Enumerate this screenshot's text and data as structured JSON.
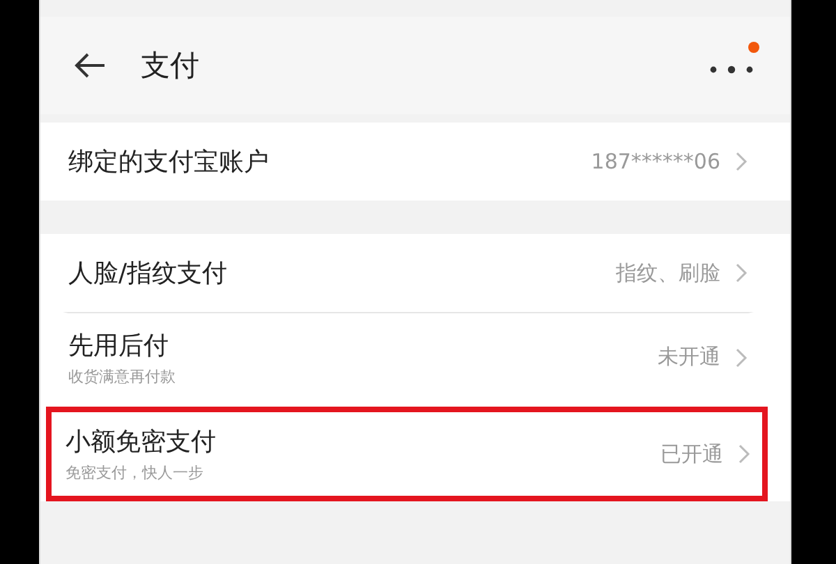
{
  "header": {
    "title": "支付",
    "notification_dot": true
  },
  "groups": [
    {
      "items": [
        {
          "title": "绑定的支付宝账户",
          "value": "187******06",
          "highlighted": false
        }
      ]
    },
    {
      "items": [
        {
          "title": "人脸/指纹支付",
          "value": "指纹、刷脸",
          "highlighted": false
        },
        {
          "title": "先用后付",
          "subtitle": "收货满意再付款",
          "value": "未开通",
          "highlighted": false
        },
        {
          "title": "小额免密支付",
          "subtitle": "免密支付，快人一步",
          "value": "已开通",
          "highlighted": true
        }
      ]
    }
  ]
}
